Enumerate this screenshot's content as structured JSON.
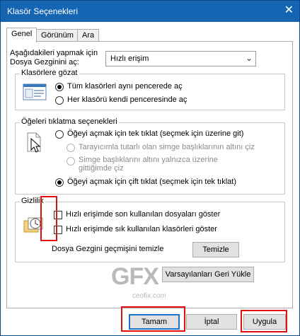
{
  "window": {
    "title": "Klasör Seçenekleri",
    "close_glyph": "✕"
  },
  "tabs": [
    "Genel",
    "Görünüm",
    "Ara"
  ],
  "browse_label": {
    "line1": "Aşağıdakileri yapmak için",
    "line2": "Dosya Gezginini aç:"
  },
  "browse_select": {
    "value": "Hızlı erişim",
    "chevron": "⌄"
  },
  "browse_folders": {
    "title": "Klasörlere gözat",
    "options": [
      "Tüm klasörleri aynı pencerede aç",
      "Her klasörü kendi penceresinde aç"
    ],
    "selected": 0
  },
  "click_items": {
    "title": "Öğeleri tıklatma seçenekleri",
    "option_single": "Öğeyi açmak için tek tıklat (seçmek için üzerine git)",
    "sub_option_1": "Tarayıcımla tutarlı olan simge başlıklarının altını çiz",
    "sub_option_2_line1": "Simge başlıklarını altını yalnızca üzerine",
    "sub_option_2_line2": "gittiğimde çiz",
    "option_double": "Öğeyi açmak için çift tıklat (seçmek için tek tıklat)",
    "selected": "double"
  },
  "privacy": {
    "title": "Gizlilik",
    "cb_recent_files": "Hızlı erişimde son kullanılan dosyaları göster",
    "cb_frequent_folders": "Hızlı erişimde sık kullanılan klasörleri göster",
    "clear_history_label": "Dosya Gezgini geçmişini temizle",
    "clear_button": "Temizle"
  },
  "restore_defaults_button": "Varsayılanları Geri Yükle",
  "watermark": {
    "logo": "GFX",
    "text": "ceofix.com"
  },
  "footer": {
    "ok": "Tamam",
    "cancel": "İptal",
    "apply": "Uygula"
  },
  "colors": {
    "titlebar": "#1565b3",
    "highlight": "#e01010",
    "default_button_border": "#1a74c9"
  }
}
